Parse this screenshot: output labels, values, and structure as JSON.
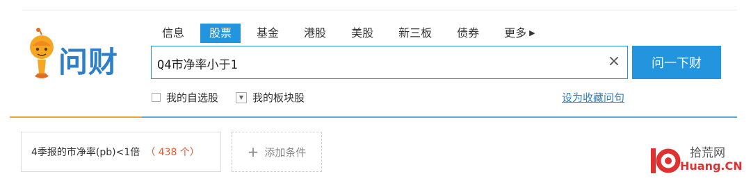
{
  "tabs": [
    {
      "label": "信息",
      "active": false
    },
    {
      "label": "股票",
      "active": true
    },
    {
      "label": "基金",
      "active": false
    },
    {
      "label": "港股",
      "active": false
    },
    {
      "label": "美股",
      "active": false
    },
    {
      "label": "新三板",
      "active": false
    },
    {
      "label": "债券",
      "active": false
    },
    {
      "label": "更多",
      "active": false
    }
  ],
  "logo": {
    "text": "问财"
  },
  "search": {
    "value": "Q4市净率小于1",
    "submit_label": "问一下财"
  },
  "options": {
    "my_watchlist": "我的自选股",
    "my_sectors": "我的板块股",
    "favorite_link": "设为收藏问句"
  },
  "conditions": [
    {
      "text": "4季报的市净率(pb)<1倍",
      "count_text": "（ 438 个）"
    }
  ],
  "add_condition": {
    "label": "添加条件"
  },
  "watermark": {
    "line1": "拾荒网",
    "line2": "Huang.CN"
  },
  "colors": {
    "accent": "#2394de",
    "highlight": "#f0a030",
    "count": "#e05a2a"
  }
}
